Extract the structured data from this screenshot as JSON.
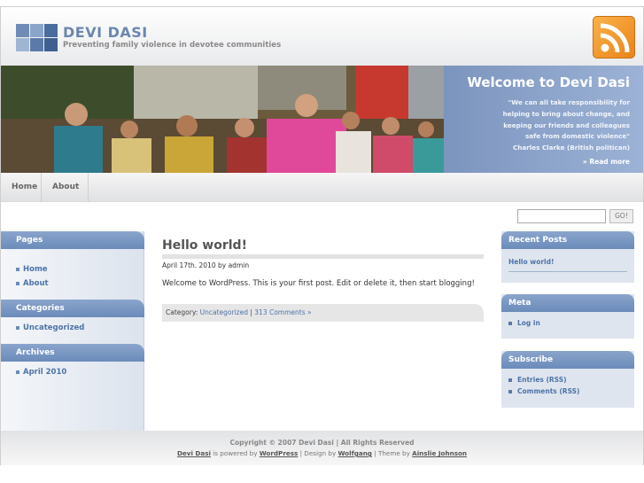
{
  "header": {
    "site_title": "DEVI DASI",
    "tagline": "Preventing family violence in devotee communities",
    "logo_colors": [
      "#6f8bb6",
      "#8ba4c9",
      "#4a6d9e",
      "#9fb5d3",
      "#5b7aa9",
      "#3f5f90"
    ],
    "rss_icon": "rss-feed-icon",
    "rss_color": "#f4a235"
  },
  "banner": {
    "photo": "group-of-women-photo",
    "welcome_title": "Welcome to Devi Dasi",
    "quote_lines": [
      "\"We can all take responsibility for",
      "helping to bring about change, and",
      "keeping our friends and colleagues",
      "safe from domestic violence\"",
      "Charles Clarke (British politican)"
    ],
    "read_more": "» Read more"
  },
  "nav": {
    "items": [
      {
        "label": "Home"
      },
      {
        "label": "About"
      }
    ]
  },
  "search": {
    "placeholder": "",
    "button_label": "GO!"
  },
  "left_sidebar": {
    "pages_heading": "Pages",
    "pages": [
      {
        "label": "Home"
      },
      {
        "label": "About"
      }
    ],
    "categories_heading": "Categories",
    "categories": [
      {
        "label": "Uncategorized"
      }
    ],
    "archives_heading": "Archives",
    "archives": [
      {
        "label": "April 2010"
      }
    ]
  },
  "post": {
    "title": "Hello world!",
    "meta": "April 17th. 2010 by admin",
    "body": "Welcome to WordPress. This is your first post. Edit or delete it, then start blogging!",
    "category_label": "Category: ",
    "category_link": "Uncategorized",
    "separator": " | ",
    "comments_link": "313 Comments »"
  },
  "right_sidebar": {
    "recent_heading": "Recent Posts",
    "recent": [
      {
        "label": "Hello world!"
      }
    ],
    "meta_heading": "Meta",
    "meta_links": [
      {
        "label": "Log in"
      }
    ],
    "subscribe_heading": "Subscribe",
    "subscribe_links": [
      {
        "label": "Entries (RSS)"
      },
      {
        "label": "Comments (RSS)"
      }
    ]
  },
  "footer": {
    "copyright": "Copyright © 2007 Devi Dasi | All Rights Reserved",
    "site_link": "Devi Dasi",
    "powered_text": " is powered by ",
    "wordpress_link": "WordPress",
    "design_text": " | Design by ",
    "design_link": "Wolfgang",
    "theme_text": " | Theme by ",
    "theme_link": "Ainslie Johnson"
  }
}
